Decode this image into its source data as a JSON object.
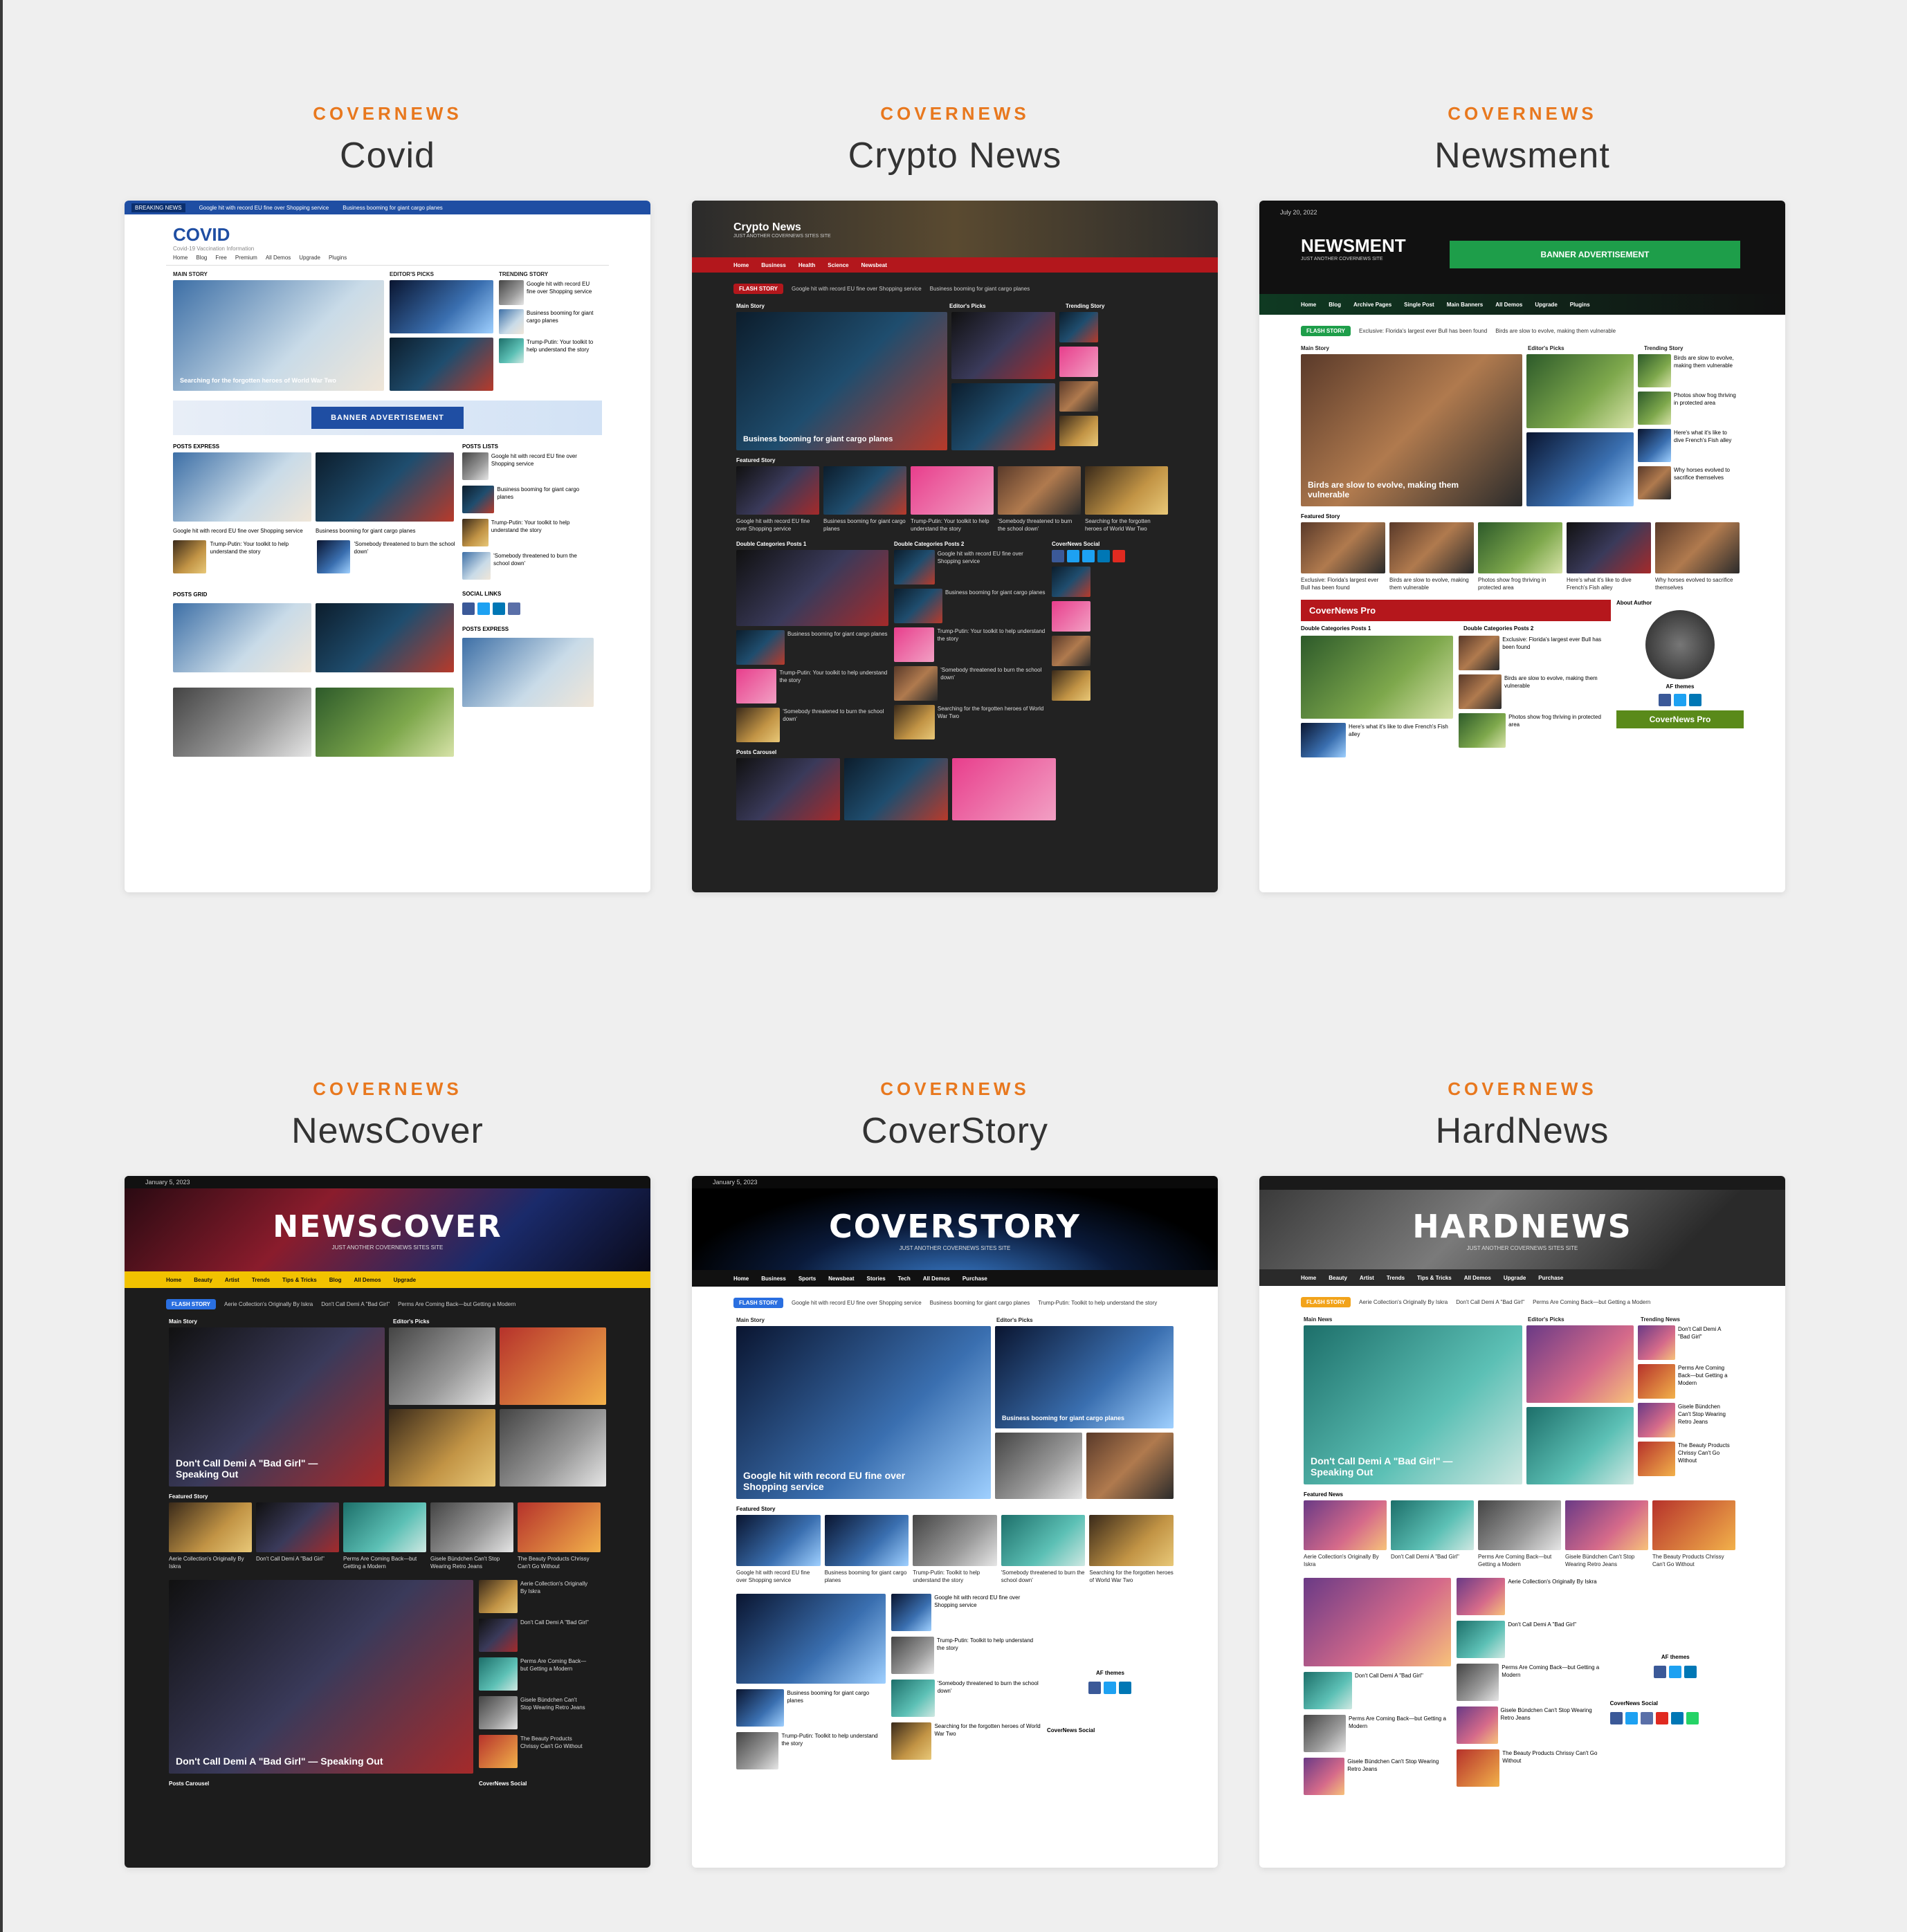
{
  "cards": [
    {
      "kicker": "COVERNEWS",
      "title": "Covid",
      "preview": {
        "logo": "COVID",
        "tagline": "Covid-19 Vaccination Information",
        "breaking": "BREAKING NEWS",
        "nav": [
          "Home",
          "Blog",
          "Free",
          "Premium",
          "All Demos",
          "Upgrade",
          "Plugins"
        ],
        "main_story_label": "MAIN STORY",
        "editors_picks_label": "EDITOR'S PICKS",
        "trending_label": "TRENDING STORY",
        "main_caption": "Searching for the forgotten heroes of World War Two",
        "banner": "BANNER ADVERTISEMENT",
        "posts_express": "POSTS EXPRESS",
        "posts_lists": "POSTS LISTS",
        "posts_grid": "POSTS GRID",
        "social_links": "SOCIAL LINKS",
        "items": [
          "Google hit with record EU fine over Shopping service",
          "Business booming for giant cargo planes",
          "Trump-Putin: Your toolkit to help understand the story",
          "'Somebody threatened to burn the school down'"
        ]
      }
    },
    {
      "kicker": "COVERNEWS",
      "title": "Crypto News",
      "preview": {
        "logo": "Crypto News",
        "tagline": "JUST ANOTHER COVERNEWS SITES SITE",
        "nav": [
          "Home",
          "Business",
          "Health",
          "Science",
          "Newsbeat"
        ],
        "flash": "FLASH STORY",
        "main_story_label": "Main Story",
        "editors_picks_label": "Editor's Picks",
        "trending_label": "Trending Story",
        "main_caption": "Business booming for giant cargo planes",
        "featured_label": "Featured Story",
        "double1": "Double Categories Posts 1",
        "double2": "Double Categories Posts 2",
        "social_label": "CoverNews Social",
        "carousel_label": "Posts Carousel",
        "items": [
          "Google hit with record EU fine over Shopping service",
          "Business booming for giant cargo planes",
          "Trump-Putin: Your toolkit to help understand the story",
          "'Somebody threatened to burn the school down'",
          "Searching for the forgotten heroes of World War Two"
        ]
      }
    },
    {
      "kicker": "COVERNEWS",
      "title": "Newsment",
      "preview": {
        "date": "July 20, 2022",
        "logo": "NEWSMENT",
        "tagline": "JUST ANOTHER COVERNEWS SITE",
        "banner": "BANNER ADVERTISEMENT",
        "nav": [
          "Home",
          "Blog",
          "Archive Pages",
          "Single Post",
          "Main Banners",
          "All Demos",
          "Upgrade",
          "Plugins"
        ],
        "flash": "FLASH STORY",
        "main_story_label": "Main Story",
        "editors_picks_label": "Editor's Picks",
        "trending_label": "Trending Story",
        "main_caption": "Birds are slow to evolve, making them vulnerable",
        "featured_label": "Featured Story",
        "promo": "CoverNews Pro",
        "double1": "Double Categories Posts 1",
        "double2": "Double Categories Posts 2",
        "about_label": "About Author",
        "author": "AF themes",
        "promo2": "CoverNews Pro",
        "items": [
          "Exclusive: Florida's largest ever Bull has been found",
          "Birds are slow to evolve, making them vulnerable",
          "Photos show frog thriving in protected area",
          "Here's what it's like to dive French's Fish alley",
          "Why horses evolved to sacrifice themselves"
        ]
      }
    },
    {
      "kicker": "COVERNEWS",
      "title": "NewsCover",
      "preview": {
        "date": "January 5, 2023",
        "logo": "NEWSCOVER",
        "tagline": "JUST ANOTHER COVERNEWS SITES SITE",
        "nav": [
          "Home",
          "Beauty",
          "Artist",
          "Trends",
          "Tips & Tricks",
          "Blog",
          "All Demos",
          "Upgrade"
        ],
        "flash": "FLASH STORY",
        "main_story_label": "Main Story",
        "editors_picks_label": "Editor's Picks",
        "main_caption": "Don't Call Demi A \"Bad Girl\" — Speaking Out",
        "featured_label": "Featured Story",
        "second_caption": "Don't Call Demi A \"Bad Girl\" — Speaking Out",
        "carousel_label": "Posts Carousel",
        "social_label": "CoverNews Social",
        "items": [
          "Aerie Collection's Originally By Iskra",
          "Don't Call Demi A \"Bad Girl\"",
          "Perms Are Coming Back—but Getting a Modern",
          "Gisele Bündchen Can't Stop Wearing Retro Jeans",
          "The Beauty Products Chrissy Can't Go Without"
        ]
      }
    },
    {
      "kicker": "COVERNEWS",
      "title": "CoverStory",
      "preview": {
        "date": "January 5, 2023",
        "logo": "COVERSTORY",
        "tagline": "JUST ANOTHER COVERNEWS SITES SITE",
        "nav": [
          "Home",
          "Business",
          "Sports",
          "Newsbeat",
          "Stories",
          "Tech",
          "All Demos",
          "Purchase"
        ],
        "flash": "FLASH STORY",
        "main_story_label": "Main Story",
        "editors_picks_label": "Editor's Picks",
        "main_caption": "Google hit with record EU fine over Shopping service",
        "side_caption": "Business booming for giant cargo planes",
        "featured_label": "Featured Story",
        "author": "AF themes",
        "social_label": "CoverNews Social",
        "items": [
          "Google hit with record EU fine over Shopping service",
          "Business booming for giant cargo planes",
          "Trump-Putin: Toolkit to help understand the story",
          "'Somebody threatened to burn the school down'",
          "Searching for the forgotten heroes of World War Two"
        ]
      }
    },
    {
      "kicker": "COVERNEWS",
      "title": "HardNews",
      "preview": {
        "logo": "HARDNEWS",
        "tagline": "JUST ANOTHER COVERNEWS SITES SITE",
        "nav": [
          "Home",
          "Beauty",
          "Artist",
          "Trends",
          "Tips & Tricks",
          "All Demos",
          "Upgrade",
          "Purchase"
        ],
        "flash": "FLASH STORY",
        "main_story_label": "Main News",
        "editors_picks_label": "Editor's Picks",
        "trending_label": "Trending News",
        "main_caption": "Don't Call Demi A \"Bad Girl\" — Speaking Out",
        "featured_label": "Featured News",
        "author": "AF themes",
        "social_label": "CoverNews Social",
        "items": [
          "Aerie Collection's Originally By Iskra",
          "Don't Call Demi A \"Bad Girl\"",
          "Perms Are Coming Back—but Getting a Modern",
          "Gisele Bündchen Can't Stop Wearing Retro Jeans",
          "The Beauty Products Chrissy Can't Go Without"
        ]
      }
    }
  ],
  "colors": {
    "kicker": "#e8781e",
    "title": "#333333",
    "page_bg": "#efefef",
    "crypto_nav": "#b3171c",
    "newscover_nav": "#f2c200",
    "flash_blue": "#2a6fe0",
    "newsment_banner": "#1e9e4a",
    "promo_red": "#b5171c",
    "promo_green": "#5a8a1a"
  }
}
